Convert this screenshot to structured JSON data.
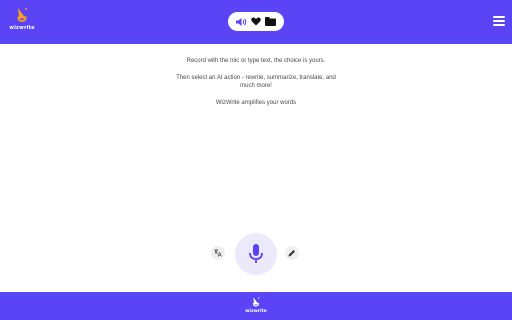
{
  "header": {
    "brand": {
      "text": "wizwrite",
      "icon": "wizard-hat-logo-icon"
    },
    "toolbar": [
      {
        "icon": "speaker-icon"
      },
      {
        "icon": "heart-icon"
      },
      {
        "icon": "folder-icon"
      }
    ],
    "menu_icon": "hamburger-menu-icon"
  },
  "intro": {
    "line1": "Record with the mic or type text, the choice is yours.",
    "line2": "Then select an AI action - rewrite, summarize, translate, and much more!",
    "line3": "WizWrite amplifies your words"
  },
  "controls": {
    "left_icon": "translate-icon",
    "center_icon": "microphone-icon",
    "right_icon": "pencil-icon"
  },
  "footer": {
    "brand": {
      "text": "wizwrite",
      "icon": "wizard-hat-logo-icon"
    }
  },
  "colors": {
    "brand": "#5a44f5",
    "mic_background": "#ebe9fb",
    "side_button_background": "#efeff2",
    "text": "#4a4a4a"
  }
}
